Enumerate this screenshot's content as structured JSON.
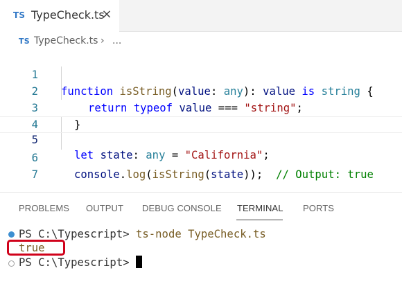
{
  "tab": {
    "badge": "TS",
    "label": "TypeCheck.ts",
    "close_glyph": "×"
  },
  "breadcrumb": {
    "badge": "TS",
    "file": "TypeCheck.ts",
    "separator": "›",
    "more": "..."
  },
  "editor": {
    "line_numbers": [
      "1",
      "2",
      "3",
      "4",
      "5",
      "6",
      "7"
    ],
    "lines": {
      "l1": [
        "function",
        " ",
        "isString",
        "(",
        "value",
        ": ",
        "any",
        "): ",
        "value",
        " ",
        "is",
        " ",
        "string",
        " {"
      ],
      "l2": [
        "return",
        " ",
        "typeof",
        " ",
        "value",
        " === ",
        "\"string\"",
        ";"
      ],
      "l3": [
        "}"
      ],
      "l5": [
        "let",
        " ",
        "state",
        ": ",
        "any",
        " = ",
        "\"California\"",
        ";"
      ],
      "l6": [
        "console",
        ".",
        "log",
        "(",
        "isString",
        "(",
        "state",
        "));  ",
        "// Output: true"
      ]
    }
  },
  "panel": {
    "tabs": [
      "PROBLEMS",
      "OUTPUT",
      "DEBUG CONSOLE",
      "TERMINAL",
      "PORTS"
    ],
    "active_tab": "TERMINAL"
  },
  "terminal": {
    "prompt1": "PS C:\\Typescript> ",
    "command": "ts-node TypeCheck.ts",
    "output": "true",
    "prompt2": "PS C:\\Typescript> "
  },
  "colors": {
    "keyword": "#0000ff",
    "function": "#795e26",
    "variable": "#001080",
    "type": "#267f99",
    "string": "#a31515",
    "comment": "#008000",
    "highlight_box": "#d0021b",
    "ts_badge": "#3178c6"
  }
}
